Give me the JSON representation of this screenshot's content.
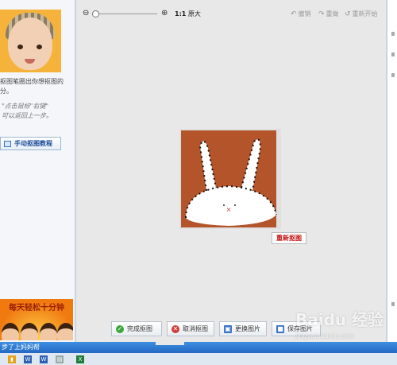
{
  "left_panel": {
    "instruction": "抠图笔圈出你想抠图的",
    "instruction2": "分。",
    "hint_line1": "\"点击鼠标\"右键\"",
    "hint_line2": "可以返回上一步。",
    "tutorial_button": "手动抠图教程",
    "ad_text": "每天轻松十分钟"
  },
  "toolbar": {
    "zoom_ratio": "1:1",
    "zoom_label": "原大",
    "undo": "撤销",
    "redo": "重做",
    "restart": "重新开始"
  },
  "canvas": {
    "redo_matting_button": "重新抠图"
  },
  "bottom_buttons": {
    "finish": "完成抠图",
    "cancel": "取消抠图",
    "replace": "更换图片",
    "save": "保存图片"
  },
  "status_bar": {
    "text": "步了上妈妈帮"
  },
  "watermark": {
    "logo": "Baidu 经验",
    "url": "jingyan.baidu.com"
  },
  "colors": {
    "accent_blue": "#2368c4",
    "art_background": "#b3542a",
    "redo_text": "#c41010"
  }
}
